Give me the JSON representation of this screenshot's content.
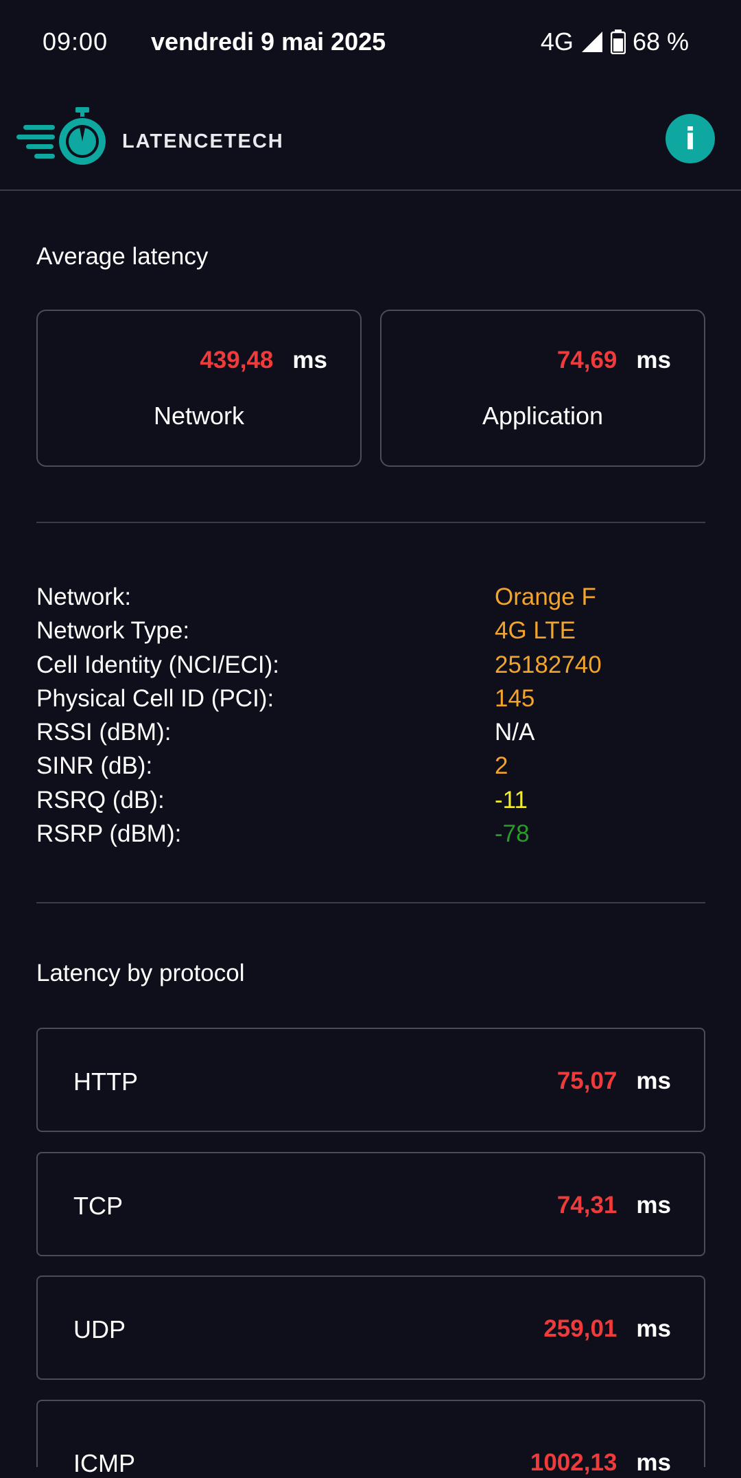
{
  "status_bar": {
    "time": "09:00",
    "date": "vendredi 9 mai 2025",
    "network": "4G",
    "battery": "68 %"
  },
  "app_bar": {
    "brand": "LATENCETECH",
    "info_label": "i"
  },
  "colors": {
    "background": "#0e0f1a",
    "accent": "#0fa8a0",
    "latency_red": "#ef3b3b",
    "orange": "#f3a42a",
    "yellow": "#f1ec2e",
    "green": "#2a9b2a"
  },
  "average_latency": {
    "title": "Average latency",
    "cards": [
      {
        "value": "439,48",
        "unit": "ms",
        "label": "Network"
      },
      {
        "value": "74,69",
        "unit": "ms",
        "label": "Application"
      }
    ]
  },
  "network_info": {
    "rows": [
      {
        "label": "Network:",
        "value": "Orange F",
        "color": "#f3a42a"
      },
      {
        "label": "Network Type:",
        "value": "4G LTE",
        "color": "#f3a42a"
      },
      {
        "label": "Cell Identity (NCI/ECI):",
        "value": "25182740",
        "color": "#f3a42a"
      },
      {
        "label": "Physical Cell ID (PCI):",
        "value": "145",
        "color": "#f3a42a"
      },
      {
        "label": "RSSI (dBM):",
        "value": "N/A",
        "color": "#ffffff"
      },
      {
        "label": "SINR (dB):",
        "value": "2",
        "color": "#f3a42a"
      },
      {
        "label": "RSRQ (dB):",
        "value": "-11",
        "color": "#f1ec2e"
      },
      {
        "label": "RSRP (dBM):",
        "value": "-78",
        "color": "#2a9b2a"
      }
    ]
  },
  "latency_by_protocol": {
    "title": "Latency by protocol",
    "items": [
      {
        "name": "HTTP",
        "value": "75,07",
        "unit": "ms"
      },
      {
        "name": "TCP",
        "value": "74,31",
        "unit": "ms"
      },
      {
        "name": "UDP",
        "value": "259,01",
        "unit": "ms"
      },
      {
        "name": "ICMP",
        "value": "1002,13",
        "unit": "ms"
      }
    ]
  }
}
